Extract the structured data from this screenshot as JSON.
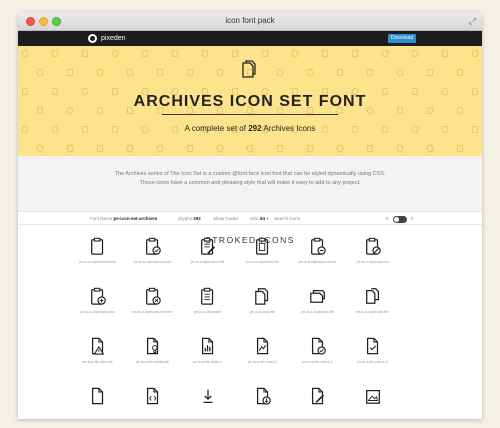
{
  "window": {
    "title": "icon font pack"
  },
  "navbar": {
    "brand": "pixeden",
    "download_label": "Download",
    "colors": {
      "bar": "#1d1d1d",
      "button": "#2d8fd0"
    }
  },
  "hero": {
    "title": "ARCHIVES ICON SET FONT",
    "subtitle_before": "A complete set of ",
    "subtitle_count": "292",
    "subtitle_after": " Archives Icons",
    "background": "#fde48c"
  },
  "description": {
    "line1": "The Archives series of The Icon Set is a custom @font-face icon font that can be styled dynamically using CSS.",
    "line2": "Those icons have a common and pleasing style that will make it easy to add to any project."
  },
  "toolbar": {
    "font_name_label": "Font Name",
    "font_name_value": "pe-icon-set-archives",
    "glyphs_label": "Glyphs",
    "glyphs_value": "292",
    "show_codes_label": "Show Codes",
    "size_label": "Size",
    "size_value": "64",
    "search_label": "Search icons",
    "toggle_left": "0",
    "toggle_right": "0"
  },
  "section": {
    "title": "STROKED ICONS"
  },
  "icons": [
    {
      "label": "pe-is-a-clipboard-blank",
      "icon": "clipboard-icon"
    },
    {
      "label": "pe-is-a-clipboard-check",
      "icon": "clipboard-check-icon"
    },
    {
      "label": "pe-is-a-clipboard-edit",
      "icon": "clipboard-edit-icon"
    },
    {
      "label": "pe-is-a-clipboard-file",
      "icon": "clipboard-file-icon"
    },
    {
      "label": "pe-is-a-clipboard-minus",
      "icon": "clipboard-minus-icon"
    },
    {
      "label": "pe-is-a-clipboard-no",
      "icon": "clipboard-no-icon"
    },
    {
      "label": "pe-is-a-clipboard-plus",
      "icon": "clipboard-plus-icon"
    },
    {
      "label": "pe-is-a-clipboard-remove",
      "icon": "clipboard-remove-icon"
    },
    {
      "label": "pe-is-a-clipboard",
      "icon": "clipboard-text-icon"
    },
    {
      "label": "pe-is-a-copy-file",
      "icon": "copy-file-icon"
    },
    {
      "label": "pe-is-a-duplicate-file",
      "icon": "duplicate-file-icon"
    },
    {
      "label": "pe-is-a-duplicate-file",
      "icon": "duplicate-files-icon"
    },
    {
      "label": "pe-is-a-file-alert-alt",
      "icon": "file-alert-icon"
    },
    {
      "label": "pe-is-a-file-certificate",
      "icon": "file-certificate-icon"
    },
    {
      "label": "pe-is-a-file-chart-1",
      "icon": "file-bar-chart-icon"
    },
    {
      "label": "pe-is-a-file-chart-2",
      "icon": "file-line-chart-icon"
    },
    {
      "label": "pe-is-a-file-check-1",
      "icon": "file-check-circle-icon"
    },
    {
      "label": "pe-is-a-file-check-2",
      "icon": "file-check-icon"
    },
    {
      "label": "",
      "icon": "file-blank-icon"
    },
    {
      "label": "",
      "icon": "file-code-icon"
    },
    {
      "label": "",
      "icon": "file-download-icon"
    },
    {
      "label": "",
      "icon": "file-download-circle-icon"
    },
    {
      "label": "",
      "icon": "file-edit-icon"
    },
    {
      "label": "",
      "icon": "file-image-icon"
    }
  ]
}
